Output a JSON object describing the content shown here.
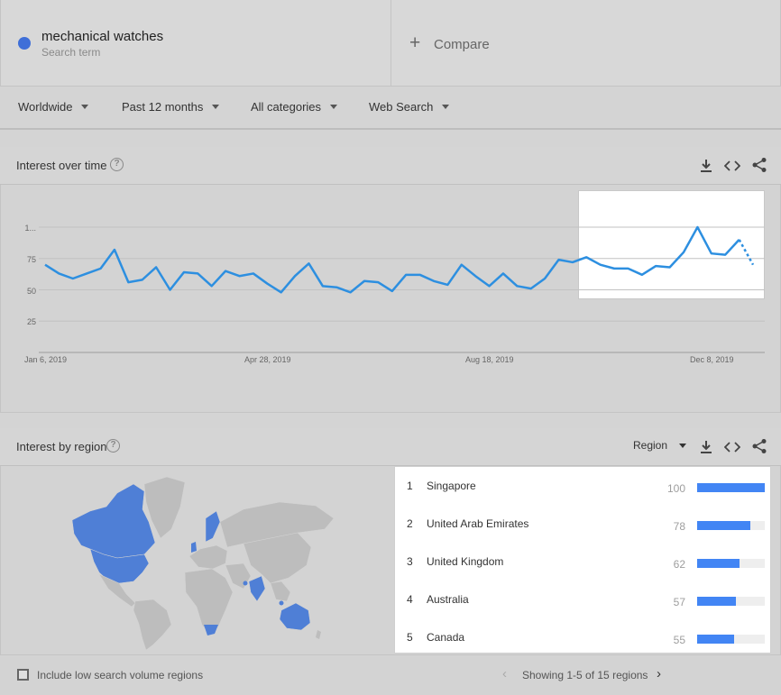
{
  "search": {
    "term": "mechanical watches",
    "term_sublabel": "Search term",
    "term_color": "#3f6fd8",
    "compare_label": "Compare"
  },
  "filters": [
    {
      "label": "Worldwide"
    },
    {
      "label": "Past 12 months"
    },
    {
      "label": "All categories"
    },
    {
      "label": "Web Search"
    }
  ],
  "interest_over_time": {
    "title": "Interest over time",
    "icons": [
      "help-icon",
      "download-icon",
      "embed-icon",
      "share-icon"
    ]
  },
  "interest_by_region": {
    "title": "Interest by region",
    "resolution_label": "Region",
    "icons": [
      "help-icon",
      "download-icon",
      "embed-icon",
      "share-icon"
    ]
  },
  "chart_data": {
    "type": "line",
    "series": [
      {
        "name": "mechanical watches",
        "color": "#2d8fe0",
        "values": [
          70,
          63,
          59,
          63,
          67,
          82,
          56,
          58,
          68,
          50,
          64,
          63,
          53,
          65,
          61,
          63,
          55,
          48,
          61,
          71,
          53,
          52,
          48,
          57,
          56,
          49,
          62,
          62,
          57,
          54,
          70,
          61,
          53,
          63,
          53,
          51,
          59,
          74,
          72,
          76,
          70,
          67,
          67,
          62,
          69,
          68,
          80,
          100,
          79,
          78,
          90
        ],
        "partial_tail": [
          90,
          70
        ]
      }
    ],
    "x_tick_labels": [
      "Jan 6, 2019",
      "Apr 28, 2019",
      "Aug 18, 2019",
      "Dec 8, 2019"
    ],
    "y_tick_labels": [
      "25",
      "50",
      "75",
      "1..."
    ],
    "y_ticks": [
      25,
      50,
      75,
      100
    ],
    "ylim": [
      0,
      100
    ],
    "grid": true
  },
  "regions": [
    {
      "rank": "1",
      "name": "Singapore",
      "value": "100",
      "fraction": 1.0
    },
    {
      "rank": "2",
      "name": "United Arab Emirates",
      "value": "78",
      "fraction": 0.78
    },
    {
      "rank": "3",
      "name": "United Kingdom",
      "value": "62",
      "fraction": 0.62
    },
    {
      "rank": "4",
      "name": "Australia",
      "value": "57",
      "fraction": 0.57
    },
    {
      "rank": "5",
      "name": "Canada",
      "value": "55",
      "fraction": 0.55
    }
  ],
  "region_bar_color": "#4285f4",
  "footer": {
    "checkbox_label": "Include low search volume regions",
    "pager_text": "Showing 1-5 of 15 regions"
  }
}
